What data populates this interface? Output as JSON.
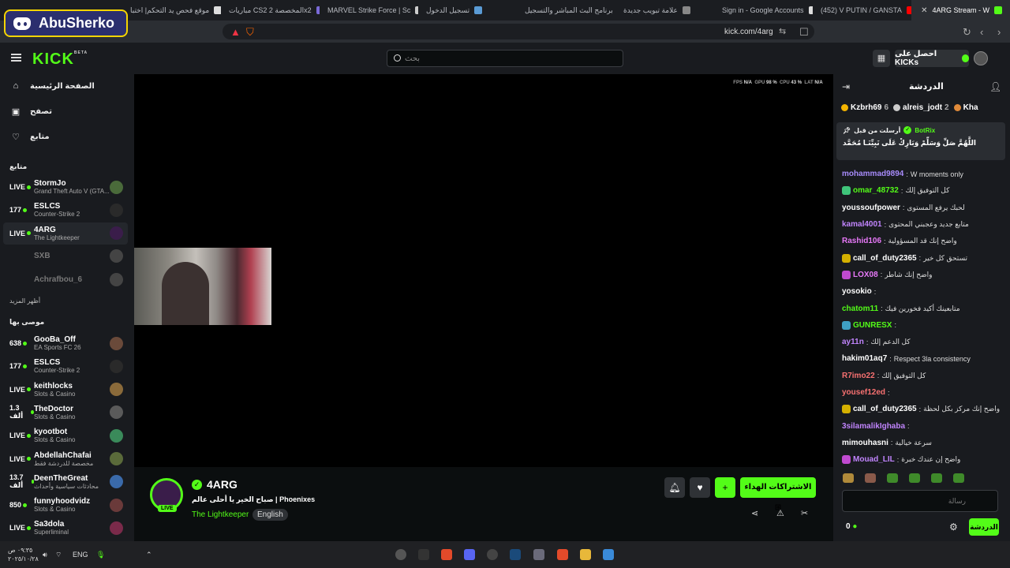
{
  "browser": {
    "tabs": [
      {
        "title": "4ARG Stream - W",
        "color": "#53fc18",
        "active": true
      },
      {
        "title": "(452) V PUTIN / GANSTA",
        "color": "#ff0000"
      },
      {
        "title": "Sign in - Google Accounts",
        "color": "#dddddd"
      },
      {
        "title": "علامة تبويب جديدة",
        "color": "#888888"
      },
      {
        "title": "برنامج البث المباشر والتسجيل",
        "color": "#53fc18"
      },
      {
        "title": "تسجيل الدخول",
        "color": "#5a9bd5"
      },
      {
        "title": "MARVEL Strike Force | Sc",
        "color": "#cccccc"
      },
      {
        "title": "مباريات CS2 المخصصة 2x2",
        "color": "#7a6ad8"
      },
      {
        "title": "موقع فحص يد التحكم| اختبا",
        "color": "#dddddd"
      }
    ],
    "url": "kick.com/4arg",
    "tab_close": "✕"
  },
  "overlay_badge": {
    "name": "AbuSherko"
  },
  "header": {
    "logo": "KICK",
    "beta": "BETA",
    "search_placeholder": "بحث",
    "get_kicks": "احصل على KICKs"
  },
  "sidebar": {
    "nav": [
      {
        "label": "الصفحة الرئيسية",
        "icon": "⌂"
      },
      {
        "label": "تصفح",
        "icon": "▣"
      },
      {
        "label": "متابع",
        "icon": "♡"
      }
    ],
    "following_title": "متابع",
    "following": [
      {
        "count": "LIVE",
        "name": "StormJo",
        "game": "Grand Theft Auto V (GTA...",
        "av": "#4a6a3a"
      },
      {
        "count": "177",
        "name": "ESLCS",
        "game": "Counter-Strike 2",
        "av": "#2a2a2a"
      },
      {
        "count": "LIVE",
        "name": "4ARG",
        "game": "The Lightkeeper",
        "av": "#3a1d4a",
        "sel": true
      },
      {
        "count": "",
        "name": "SXB",
        "game": "",
        "av": "#444",
        "off": true
      },
      {
        "count": "",
        "name": "Achrafbou_6",
        "game": "",
        "av": "#444",
        "off": true
      }
    ],
    "show_more": "أظهر المزيد",
    "recommended_title": "موصى بها",
    "recommended": [
      {
        "count": "638",
        "name": "GooBa_Off",
        "game": "EA Sports FC 26",
        "av": "#6a4a3a"
      },
      {
        "count": "177",
        "name": "ESLCS",
        "game": "Counter-Strike 2",
        "av": "#2a2a2a"
      },
      {
        "count": "LIVE",
        "name": "keithlocks",
        "game": "Slots & Casino",
        "av": "#8a6a3a"
      },
      {
        "count": "1.3 ألف",
        "name": "TheDoctor",
        "game": "Slots & Casino",
        "av": "#5a5a5a"
      },
      {
        "count": "LIVE",
        "name": "kyootbot",
        "game": "Slots & Casino",
        "av": "#3a8a5a"
      },
      {
        "count": "LIVE",
        "name": "AbdellahChafai",
        "game": "مخصصة للدردشة فقط",
        "av": "#5a6a3a"
      },
      {
        "count": "13.7 ألف",
        "name": "DeenTheGreat",
        "game": "محادثات سياسية وأحداث",
        "av": "#3a6aaa"
      },
      {
        "count": "850",
        "name": "funnyhoodvidz",
        "game": "Slots & Casino",
        "av": "#6a3a3a"
      },
      {
        "count": "LIVE",
        "name": "Sa3dola",
        "game": "Superliminal",
        "av": "#7a2a4a"
      }
    ]
  },
  "player": {
    "stats": [
      {
        "label": "FPS",
        "value": "N/A"
      },
      {
        "label": "GPU",
        "value": "98 %"
      },
      {
        "label": "CPU",
        "value": "43 %"
      },
      {
        "label": "LAT",
        "value": "N/A"
      }
    ]
  },
  "stream": {
    "channel": "4ARG",
    "live": "LIVE",
    "title": "صباح الخير يا أحلى عالم | Phoenixes",
    "category": "The Lightkeeper",
    "language": "English",
    "subscribe": "الاشتراكات الهداء"
  },
  "chat": {
    "title": "الدردشة",
    "top_gifters": [
      {
        "name": "Kzbrh69",
        "count": "6",
        "color": "#f4b400"
      },
      {
        "name": "alreis_jodt",
        "count": "2",
        "color": "#cccccc"
      },
      {
        "name": "Kha",
        "count": "",
        "color": "#e08a3a"
      }
    ],
    "pinned": {
      "by": "أرسلت من قبل",
      "user": "BotRix",
      "message": "اللَّهُمَّ صَلِّ وَسَلِّمْ وَبَارِكْ عَلَى نَبِيِّنَـا مُحَمَّد"
    },
    "messages": [
      {
        "user": "mohammad9894",
        "color": "#a78bfa",
        "text": "W moments only",
        "badge": ""
      },
      {
        "user": "omar_48732",
        "color": "#53fc18",
        "text": "كل التوفيق إلك",
        "badge": "#3fc47a"
      },
      {
        "user": "youssoufpower",
        "color": "#ffffff",
        "text": "لحبك يرفع المستوى",
        "badge": ""
      },
      {
        "user": "kamal4001",
        "color": "#c084fc",
        "text": "متابع جديد وعجبني المحتوى",
        "badge": ""
      },
      {
        "user": "Rashid106",
        "color": "#e879f9",
        "text": "واضح إنك قد المسؤولية",
        "badge": ""
      },
      {
        "user": "call_of_duty2365",
        "color": "#ffffff",
        "text": "تستحق كل خير",
        "badge": "#d4b000"
      },
      {
        "user": "LOX08",
        "color": "#e879f9",
        "text": "واضح إنك شاطر",
        "badge": "#c04ad0"
      },
      {
        "user": "yosokio",
        "color": "#ffffff",
        "text": "",
        "badge": ""
      },
      {
        "user": "chatom11",
        "color": "#53fc18",
        "text": "متابعينك أكيد فخورين فيك",
        "badge": ""
      },
      {
        "user": "GUNRESX",
        "color": "#53fc18",
        "text": "",
        "badge": "#3fa0c4"
      },
      {
        "user": "ay11n",
        "color": "#c084fc",
        "text": "كل الدعم إلك",
        "badge": ""
      },
      {
        "user": "hakim01aq7",
        "color": "#ffffff",
        "text": "Respect 3la consistency",
        "badge": ""
      },
      {
        "user": "R7imo22",
        "color": "#f87171",
        "text": "كل التوفيق إلك",
        "badge": ""
      },
      {
        "user": "yousef12ed",
        "color": "#f87171",
        "text": "",
        "badge": ""
      },
      {
        "user": "call_of_duty2365",
        "color": "#ffffff",
        "text": "واضح إنك مركز بكل لحظة",
        "badge": "#d4b000"
      },
      {
        "user": "3silamalikIghaba",
        "color": "#c084fc",
        "text": "",
        "badge": ""
      },
      {
        "user": "mimouhasni",
        "color": "#ffffff",
        "text": "سرعة خيالية",
        "badge": ""
      },
      {
        "user": "Mouad_LIL",
        "color": "#c084fc",
        "text": "واضح إن عندك خبرة",
        "badge": "#c04ad0"
      }
    ],
    "input_placeholder": "رسالة",
    "count": "0",
    "send": "الدردشة"
  },
  "taskbar": {
    "time": "٠٩:٣٥ ص",
    "date": "٢٠٢٥/١٠/٢٨",
    "lang": "ENG"
  }
}
